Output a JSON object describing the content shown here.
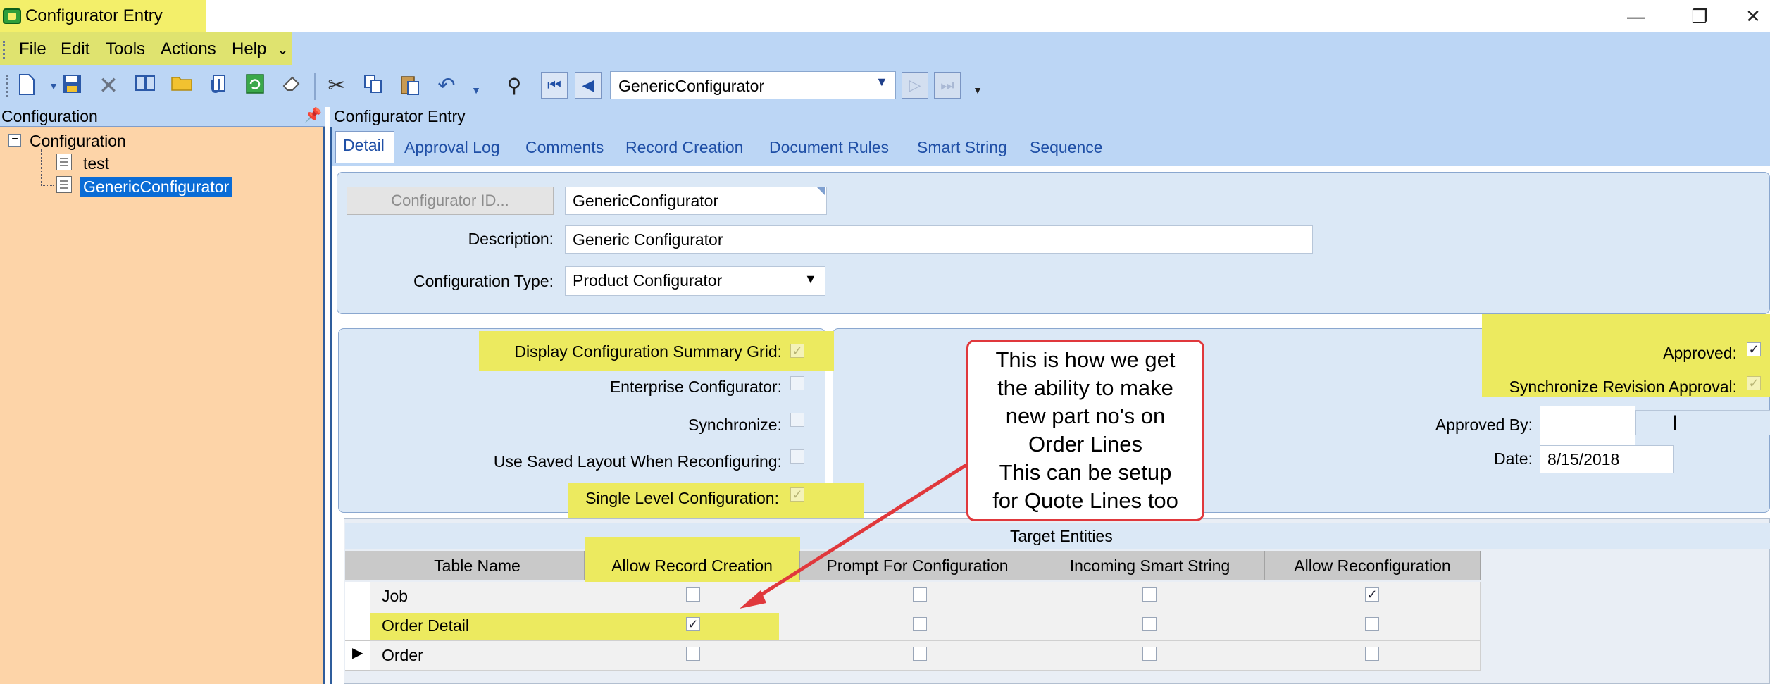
{
  "window": {
    "title": "Configurator Entry",
    "minimize_glyph": "—",
    "restore_glyph": "❐",
    "close_glyph": "✕"
  },
  "menu": {
    "items": [
      "File",
      "Edit",
      "Tools",
      "Actions",
      "Help"
    ],
    "overflow": "⌄"
  },
  "toolbar": {
    "search_value": "GenericConfigurator",
    "icons": [
      "new-icon",
      "save-icon",
      "delete-icon",
      "book-icon",
      "folder-icon",
      "attach-icon",
      "refresh-icon",
      "eraser-icon",
      "cut-icon",
      "copy-icon",
      "paste-icon",
      "undo-icon",
      "find-icon",
      "first-record-icon",
      "previous-record-icon",
      "next-record-icon",
      "last-record-icon"
    ]
  },
  "left_panel": {
    "header": "Configuration",
    "tree": {
      "root": "Configuration",
      "items": [
        "test",
        "GenericConfigurator"
      ]
    }
  },
  "right_panel": {
    "header": "Configurator Entry",
    "tabs": [
      "Detail",
      "Approval Log",
      "Comments",
      "Record Creation",
      "Document Rules",
      "Smart String",
      "Sequence"
    ],
    "active_tab": "Detail"
  },
  "form": {
    "configurator_id_button": "Configurator ID...",
    "configurator_id_value": "GenericConfigurator",
    "description_label": "Description:",
    "description_value": "Generic Configurator",
    "type_label": "Configuration Type:",
    "type_value": "Product Configurator",
    "checkboxes": [
      {
        "label": "Display Configuration Summary Grid:",
        "checked": true
      },
      {
        "label": "Enterprise Configurator:",
        "checked": false
      },
      {
        "label": "Synchronize:",
        "checked": false
      },
      {
        "label": "Use Saved Layout When Reconfiguring:",
        "checked": false
      },
      {
        "label": "Single Level Configuration:",
        "checked": true
      }
    ],
    "approved_label": "Approved:",
    "approved_checked": true,
    "sync_revision_label": "Synchronize Revision Approval:",
    "sync_revision_checked": true,
    "approved_by_label": "Approved By:",
    "approved_by_value": "",
    "date_label": "Date:",
    "date_value": "8/15/2018"
  },
  "grid": {
    "title": "Target Entities",
    "columns": [
      "Table Name",
      "Allow Record Creation",
      "Prompt For Configuration",
      "Incoming Smart String",
      "Allow Reconfiguration"
    ],
    "rows": [
      {
        "name": "Job",
        "values": [
          false,
          false,
          false,
          true
        ]
      },
      {
        "name": "Order Detail",
        "values": [
          true,
          false,
          false,
          false
        ]
      },
      {
        "name": "Order",
        "values": [
          false,
          false,
          false,
          false
        ]
      }
    ],
    "current_row_marker": "▶"
  },
  "callout": {
    "lines": [
      "This is how we get",
      "the ability to make",
      "new part no's on",
      "Order Lines",
      "This can be setup",
      "for Quote Lines too"
    ]
  },
  "colors": {
    "highlight": "#ecea5f",
    "accent_blue": "#bcd6f5",
    "panel_orange": "#fdd4a8",
    "callout_red": "#e0383c"
  }
}
